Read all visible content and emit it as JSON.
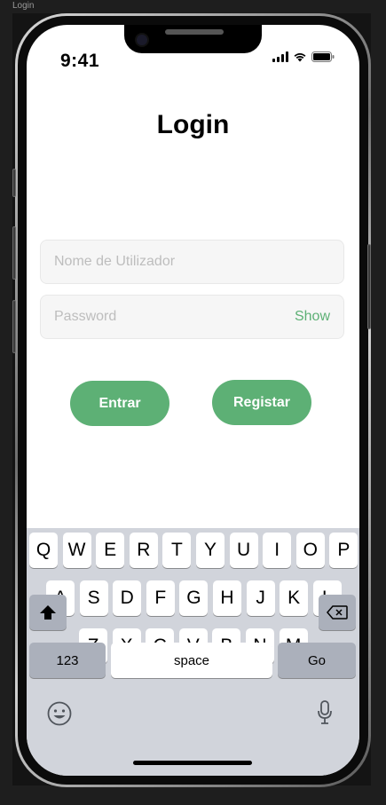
{
  "frame_label": "Login",
  "status": {
    "time": "9:41"
  },
  "screen": {
    "title": "Login",
    "username_placeholder": "Nome de Utilizador",
    "password_placeholder": "Password",
    "show_label": "Show",
    "enter_label": "Entrar",
    "register_label": "Registar"
  },
  "keyboard": {
    "row1": [
      "Q",
      "W",
      "E",
      "R",
      "T",
      "Y",
      "U",
      "I",
      "O",
      "P"
    ],
    "row2": [
      "A",
      "S",
      "D",
      "F",
      "G",
      "H",
      "J",
      "K",
      "L"
    ],
    "row3": [
      "Z",
      "X",
      "C",
      "V",
      "B",
      "N",
      "M"
    ],
    "numbers_label": "123",
    "space_label": "space",
    "go_label": "Go",
    "shift_icon": "shift-icon",
    "backspace_icon": "backspace-icon",
    "emoji_icon": "emoji-icon",
    "mic_icon": "microphone-icon"
  },
  "colors": {
    "accent": "#5db075",
    "keyboard_bg": "#d1d4db"
  }
}
